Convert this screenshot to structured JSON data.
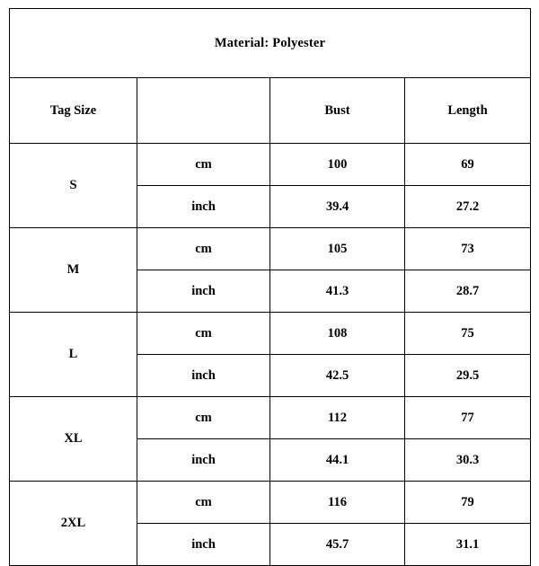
{
  "table": {
    "title": "Material: Polyester",
    "headers": {
      "tag_size": "Tag Size",
      "unit": "",
      "bust": "Bust",
      "length": "Length"
    },
    "units": {
      "cm": "cm",
      "inch": "inch"
    },
    "colors": {
      "border": "#000000",
      "background": "#ffffff",
      "highlight": "#bebebe",
      "text": "#000000"
    },
    "rows": [
      {
        "size": "S",
        "cm": {
          "unit": "cm",
          "bust": "100",
          "length": "69"
        },
        "inch": {
          "unit": "inch",
          "bust": "39.4",
          "length": "27.2"
        }
      },
      {
        "size": "M",
        "cm": {
          "unit": "cm",
          "bust": "105",
          "length": "73"
        },
        "inch": {
          "unit": "inch",
          "bust": "41.3",
          "length": "28.7"
        }
      },
      {
        "size": "L",
        "cm": {
          "unit": "cm",
          "bust": "108",
          "length": "75"
        },
        "inch": {
          "unit": "inch",
          "bust": "42.5",
          "length": "29.5"
        }
      },
      {
        "size": "XL",
        "cm": {
          "unit": "cm",
          "bust": "112",
          "length": "77"
        },
        "inch": {
          "unit": "inch",
          "bust": "44.1",
          "length": "30.3"
        }
      },
      {
        "size": "2XL",
        "cm": {
          "unit": "cm",
          "bust": "116",
          "length": "79"
        },
        "inch": {
          "unit": "inch",
          "bust": "45.7",
          "length": "31.1"
        }
      }
    ]
  },
  "chart_data": {
    "type": "table",
    "title": "Material: Polyester",
    "columns": [
      "Tag Size",
      "",
      "Bust",
      "Length"
    ],
    "categories": [
      "S",
      "M",
      "L",
      "XL",
      "2XL"
    ],
    "series": [
      {
        "name": "Bust (cm)",
        "values": [
          100,
          105,
          108,
          112,
          116
        ]
      },
      {
        "name": "Length (cm)",
        "values": [
          69,
          73,
          75,
          77,
          79
        ]
      },
      {
        "name": "Bust (inch)",
        "values": [
          39.4,
          41.3,
          42.5,
          44.1,
          45.7
        ]
      },
      {
        "name": "Length (inch)",
        "values": [
          27.2,
          28.7,
          29.5,
          30.3,
          31.1
        ]
      }
    ],
    "highlighted_rows": "inch",
    "grid": true,
    "legend": "none"
  }
}
